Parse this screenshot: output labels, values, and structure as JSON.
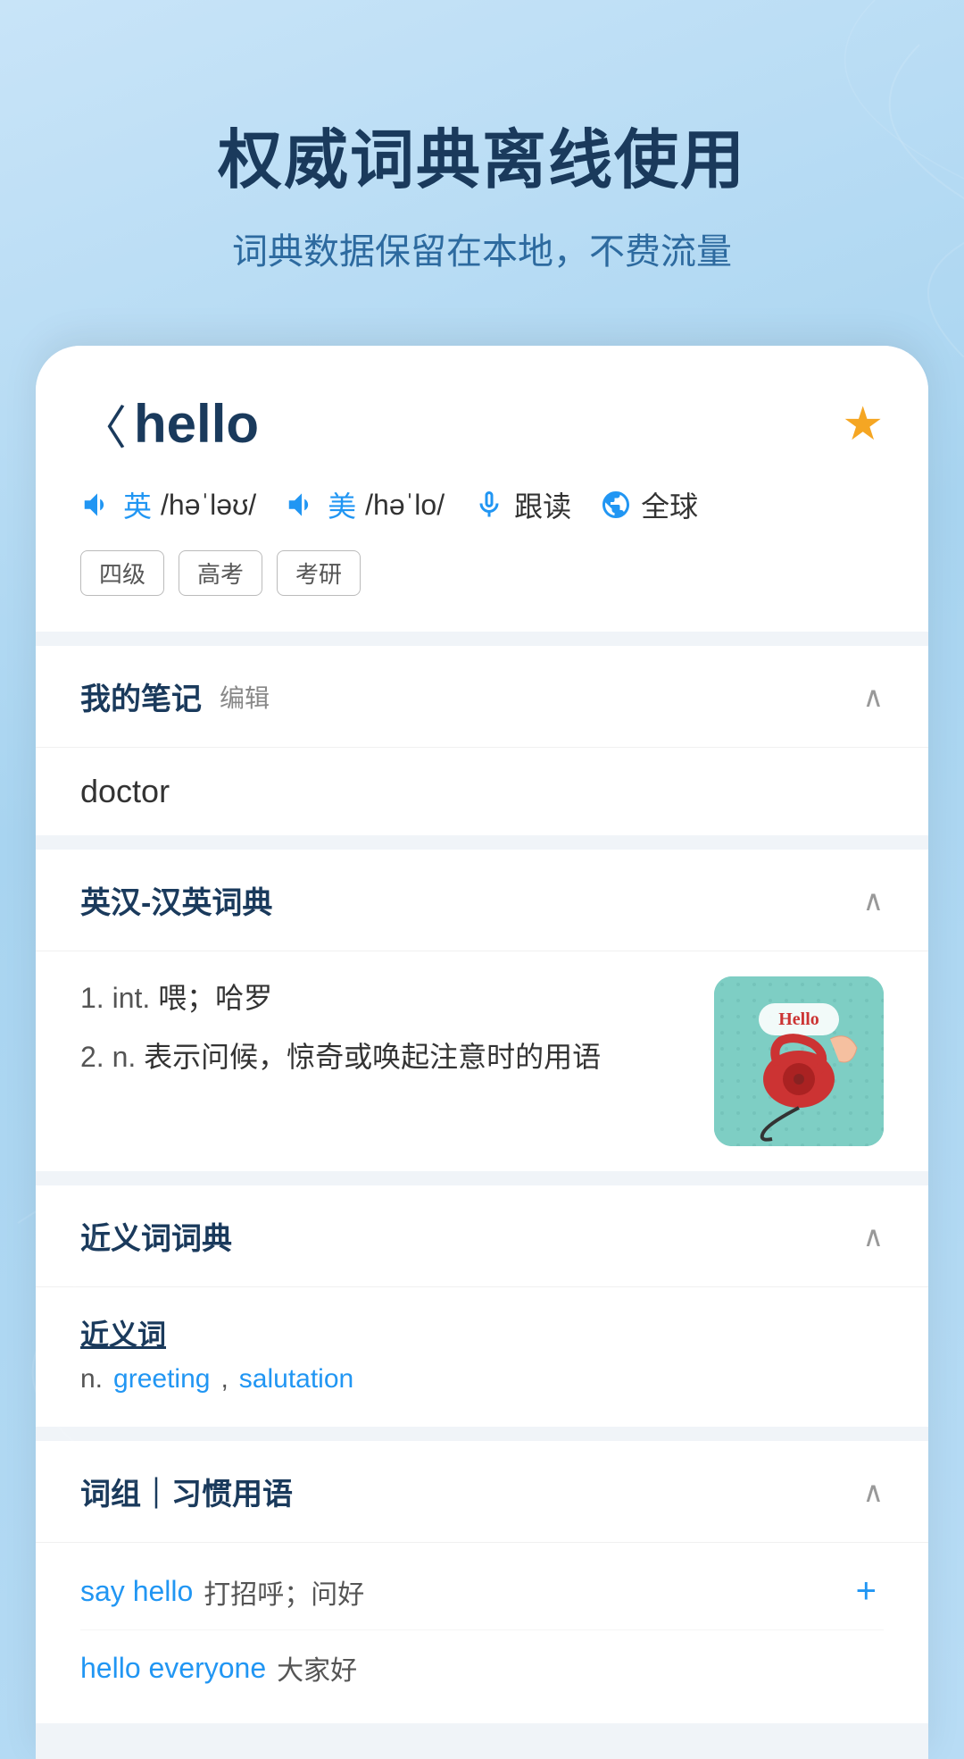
{
  "background": {
    "gradient_start": "#c8e4f8",
    "gradient_end": "#a8d4f0"
  },
  "header": {
    "title": "权威词典离线使用",
    "subtitle": "词典数据保留在本地，不费流量"
  },
  "word_card": {
    "back_arrow": "〈",
    "word": "hello",
    "star_filled": "★",
    "pronunciations": [
      {
        "lang": "英",
        "phonetic": "/həˈləʊ/"
      },
      {
        "lang": "美",
        "phonetic": "/həˈlo/"
      }
    ],
    "actions": [
      {
        "icon": "mic",
        "label": "跟读"
      },
      {
        "icon": "globe",
        "label": "全球"
      }
    ],
    "tags": [
      "四级",
      "高考",
      "考研"
    ]
  },
  "notes_section": {
    "title": "我的笔记",
    "edit_label": "编辑",
    "content": "doctor",
    "collapsed": false
  },
  "dict_section": {
    "title": "英汉-汉英词典",
    "collapsed": false,
    "definitions": [
      {
        "num": "1.",
        "pos": "int.",
        "text": "喂；哈罗"
      },
      {
        "num": "2.",
        "pos": "n.",
        "text": "表示问候，惊奇或唤起注意时的用语"
      }
    ],
    "image_text": "Hello"
  },
  "synonyms_section": {
    "title": "近义词词典",
    "collapsed": false,
    "sub_title": "近义词",
    "pos": "n.",
    "words": [
      "greeting",
      "salutation"
    ]
  },
  "phrases_section": {
    "title": "词组｜习惯用语",
    "collapsed": false,
    "phrases": [
      {
        "en": "say hello",
        "cn": "打招呼；问好",
        "has_add": true
      },
      {
        "en": "hello everyone",
        "cn": "大家好",
        "has_add": false
      }
    ]
  }
}
